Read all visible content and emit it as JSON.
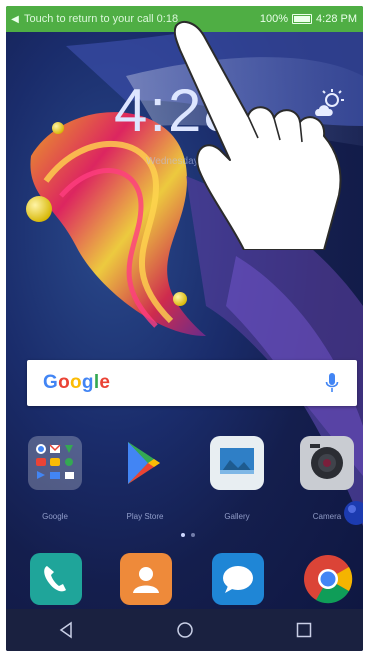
{
  "status_bar": {
    "notification_text": "Touch to return to your call 0:18",
    "battery": "100%",
    "time": "4:28 PM"
  },
  "lock": {
    "clock": "4:28",
    "date_text": "Wednesday, Touch to"
  },
  "search_bar": {
    "logo_letters": [
      "G",
      "o",
      "o",
      "g",
      "l",
      "e"
    ],
    "logo_colors": [
      "#4285F4",
      "#EA4335",
      "#FBBC05",
      "#4285F4",
      "#34A853",
      "#EA4335"
    ]
  },
  "apps_row": [
    {
      "name": "Google",
      "icon": "google-folder-icon"
    },
    {
      "name": "Play Store",
      "icon": "play-store-icon"
    },
    {
      "name": "Gallery",
      "icon": "gallery-icon"
    },
    {
      "name": "Camera",
      "icon": "camera-icon"
    }
  ],
  "dock": [
    {
      "icon": "phone-icon"
    },
    {
      "icon": "contacts-icon"
    },
    {
      "icon": "messages-icon"
    },
    {
      "icon": "chrome-icon"
    }
  ],
  "navbar": {
    "buttons": [
      "back-icon",
      "home-icon",
      "recents-icon"
    ]
  },
  "colors": {
    "status_green": "#4fae44",
    "accent_blue": "#4285F4"
  }
}
